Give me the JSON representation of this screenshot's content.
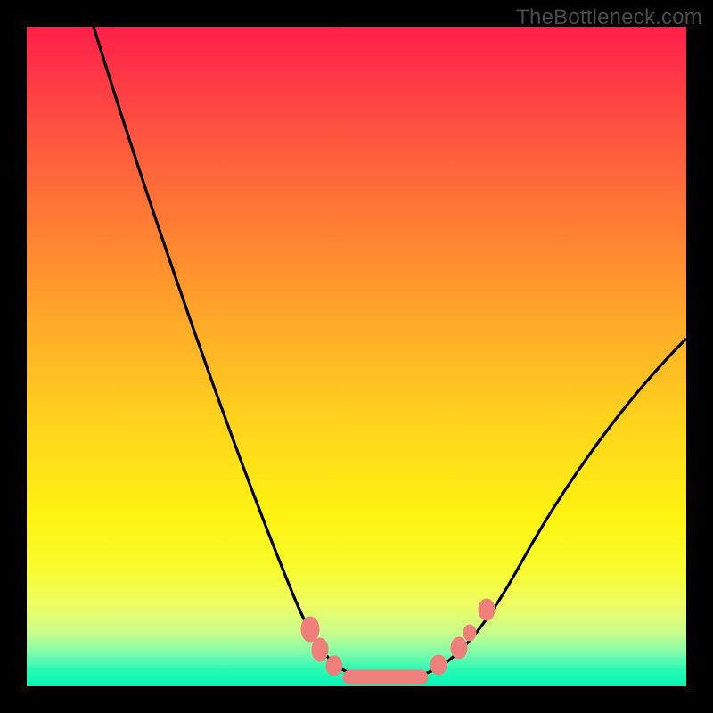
{
  "watermark": "TheBottleneck.com",
  "chart_data": {
    "type": "line",
    "title": "",
    "xlabel": "",
    "ylabel": "",
    "xlim": [
      0,
      100
    ],
    "ylim": [
      0,
      100
    ],
    "grid": false,
    "legend": false,
    "series": [
      {
        "name": "bottleneck-curve",
        "x": [
          10,
          15,
          20,
          25,
          30,
          35,
          40,
          43,
          46,
          49,
          52,
          55,
          58,
          62,
          66,
          70,
          75,
          80,
          85,
          90,
          95,
          100
        ],
        "y": [
          100,
          86,
          73,
          60,
          48,
          37,
          27,
          20,
          14,
          9,
          5,
          2.5,
          1.2,
          1.2,
          2.5,
          5,
          10,
          17,
          25,
          34,
          43,
          52
        ],
        "color": "#000000"
      }
    ],
    "annotations": {
      "bottom_dots": {
        "color": "#ee7f7a",
        "approx_x_values": [
          44,
          46,
          49,
          52,
          55,
          58,
          60,
          63,
          65,
          68
        ],
        "y": 1
      }
    },
    "background_gradient": {
      "top": "#ff1f4b",
      "mid": "#fef311",
      "bottom": "#00f8b7"
    }
  }
}
